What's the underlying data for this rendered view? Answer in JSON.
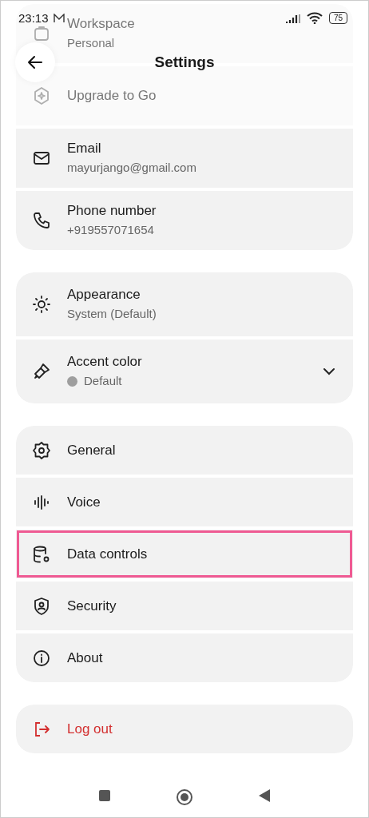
{
  "status_bar": {
    "time": "23:13",
    "battery": "75"
  },
  "header": {
    "title": "Settings"
  },
  "groups": [
    {
      "items": [
        {
          "label": "Workspace",
          "subtitle": "Personal",
          "faded": true
        },
        {
          "label": "Upgrade to Go",
          "faded": true
        },
        {
          "label": "Email",
          "subtitle": "mayurjango@gmail.com",
          "faded": false
        },
        {
          "label": "Phone number",
          "subtitle": "+919557071654",
          "faded": false
        }
      ]
    },
    {
      "items": [
        {
          "label": "Appearance",
          "subtitle": "System (Default)"
        },
        {
          "label": "Accent color",
          "subtitle": "Default",
          "color": "#9e9e9e",
          "kind": "dropdown"
        }
      ]
    },
    {
      "items": [
        {
          "label": "General",
          "highlighted": false
        },
        {
          "label": "Voice",
          "highlighted": false
        },
        {
          "label": "Data controls",
          "highlighted": true
        },
        {
          "label": "Security",
          "highlighted": false
        },
        {
          "label": "About",
          "highlighted": false
        }
      ]
    },
    {
      "items": [
        {
          "label": "Log out",
          "kind": "danger"
        }
      ]
    }
  ]
}
